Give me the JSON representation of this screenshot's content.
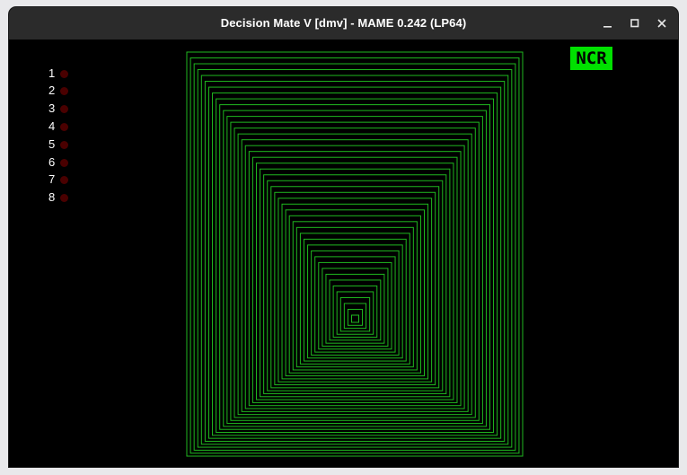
{
  "window": {
    "title": "Decision Mate V [dmv] - MAME 0.242 (LP64)",
    "controls": [
      "minimize-icon",
      "maximize-icon",
      "close-icon"
    ]
  },
  "leds": {
    "labels": [
      "1",
      "2",
      "3",
      "4",
      "5",
      "6",
      "7",
      "8"
    ],
    "color_off": "#4a0000"
  },
  "screen": {
    "pattern": "concentric-rectangles",
    "color": "#1fb81f",
    "background": "#000000"
  },
  "badge": {
    "text": "NCR",
    "background": "#00e000",
    "text_color": "#000000"
  }
}
